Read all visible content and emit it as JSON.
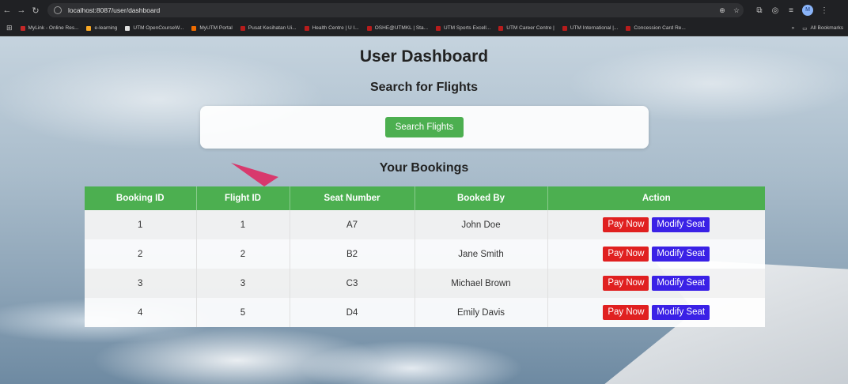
{
  "browser": {
    "url": "localhost:8087/user/dashboard",
    "profile_initial": "M",
    "bookmarks": [
      {
        "label": "MyLink - Online Res...",
        "color": "#c62828"
      },
      {
        "label": "e-learning",
        "color": "#f9a825"
      },
      {
        "label": "UTM OpenCourseW...",
        "color": "#e0e0e0"
      },
      {
        "label": "MyUTM Portal",
        "color": "#ef6c00"
      },
      {
        "label": "Pusat Kesihatan Ui...",
        "color": "#b71c1c"
      },
      {
        "label": "Health Centre | U I...",
        "color": "#b71c1c"
      },
      {
        "label": "OSHE@UTMKL | Sta...",
        "color": "#b71c1c"
      },
      {
        "label": "UTM Sports Excell...",
        "color": "#b71c1c"
      },
      {
        "label": "UTM Career Centre |",
        "color": "#b71c1c"
      },
      {
        "label": "UTM International |...",
        "color": "#b71c1c"
      },
      {
        "label": "Concession Card Re...",
        "color": "#b71c1c"
      }
    ],
    "overflow_label": "»",
    "all_bookmarks_label": "All Bookmarks"
  },
  "page": {
    "title": "User Dashboard",
    "search_heading": "Search for Flights",
    "search_button": "Search Flights",
    "bookings_heading": "Your Bookings"
  },
  "table": {
    "headers": [
      "Booking ID",
      "Flight ID",
      "Seat Number",
      "Booked By",
      "Action"
    ],
    "rows": [
      {
        "booking_id": "1",
        "flight_id": "1",
        "seat": "A7",
        "booked_by": "John Doe"
      },
      {
        "booking_id": "2",
        "flight_id": "2",
        "seat": "B2",
        "booked_by": "Jane Smith"
      },
      {
        "booking_id": "3",
        "flight_id": "3",
        "seat": "C3",
        "booked_by": "Michael Brown"
      },
      {
        "booking_id": "4",
        "flight_id": "5",
        "seat": "D4",
        "booked_by": "Emily Davis"
      }
    ],
    "pay_label": "Pay Now",
    "modify_label": "Modify Seat"
  },
  "colors": {
    "accent": "#4caf50",
    "pay": "#e02020",
    "modify": "#3a21e6"
  }
}
